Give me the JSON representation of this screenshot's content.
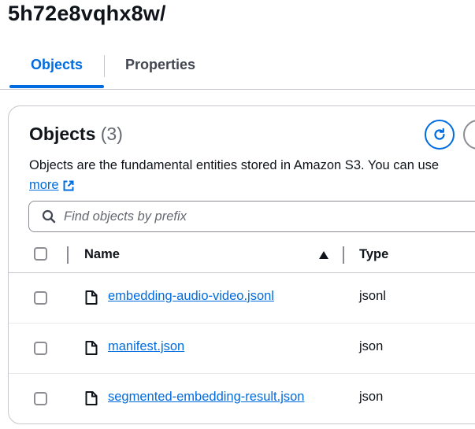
{
  "folder": {
    "title": "5h72e8vqhx8w/"
  },
  "tabs": [
    {
      "label": "Objects",
      "active": true
    },
    {
      "label": "Properties",
      "active": false
    }
  ],
  "objects_panel": {
    "title": "Objects",
    "count": "(3)",
    "description": "Objects are the fundamental entities stored in Amazon S3. You can use",
    "learn_more_label": "more",
    "refresh_icon": "refresh-icon",
    "external_link_icon": "external-link-icon"
  },
  "search": {
    "placeholder": "Find objects by prefix",
    "value": ""
  },
  "table": {
    "columns": {
      "name": "Name",
      "type": "Type"
    },
    "sort": {
      "column": "name",
      "direction": "ascending"
    },
    "rows": [
      {
        "name": "embedding-audio-video.jsonl",
        "type": "jsonl"
      },
      {
        "name": "manifest.json",
        "type": "json"
      },
      {
        "name": "segmented-embedding-result.json",
        "type": "json"
      }
    ]
  },
  "colors": {
    "accent": "#006ce0",
    "text": "#0f141a",
    "muted": "#656871",
    "border": "#c6c6cd"
  }
}
